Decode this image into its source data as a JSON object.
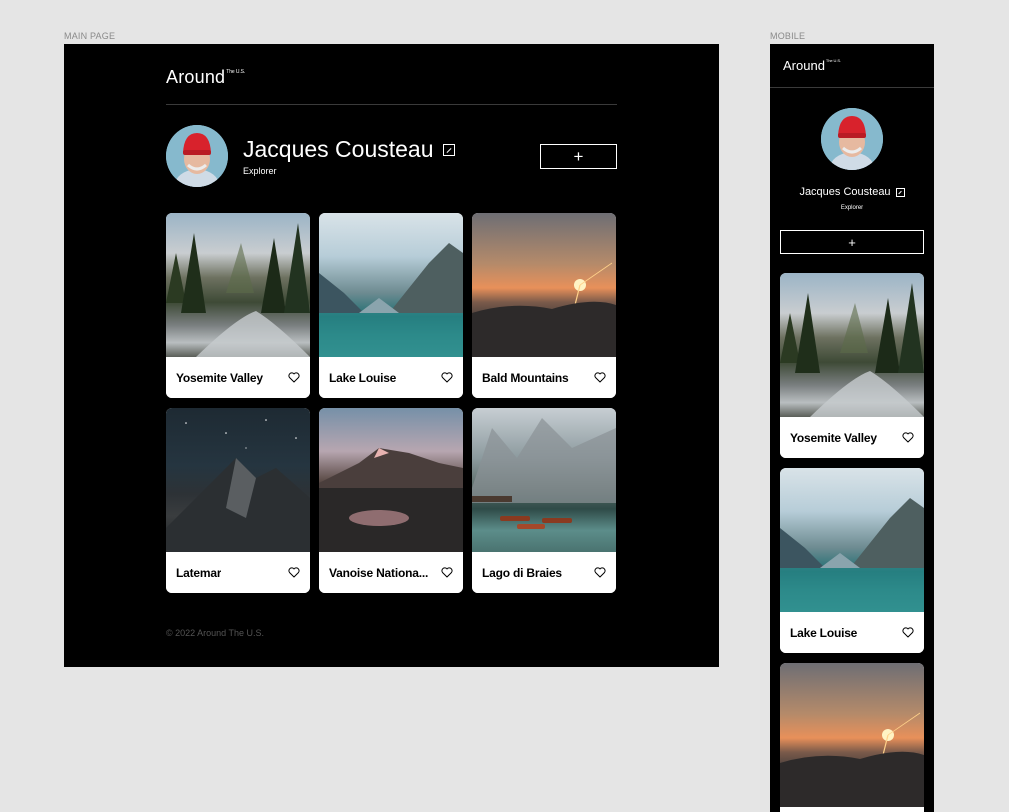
{
  "labels": {
    "main_page": "MAIN PAGE",
    "mobile": "MOBILE"
  },
  "brand": {
    "name": "Around",
    "superscript": "The U.S."
  },
  "profile": {
    "name": "Jacques Cousteau",
    "job": "Explorer",
    "add_label": "+"
  },
  "cards": [
    {
      "title": "Yosemite Valley"
    },
    {
      "title": "Lake Louise"
    },
    {
      "title": "Bald Mountains"
    },
    {
      "title": "Latemar"
    },
    {
      "title": "Vanoise Nationa..."
    },
    {
      "title": "Lago di Braies"
    }
  ],
  "footer": {
    "text": "© 2022 Around The U.S."
  },
  "colors": {
    "page_bg": "#e5e5e5",
    "frame_bg": "#000000",
    "card_bg": "#ffffff",
    "text": "#ffffff",
    "footer_text": "#545454"
  },
  "icons": {
    "edit": "pencil-square-icon",
    "like": "heart-outline-icon",
    "add": "plus-icon"
  }
}
